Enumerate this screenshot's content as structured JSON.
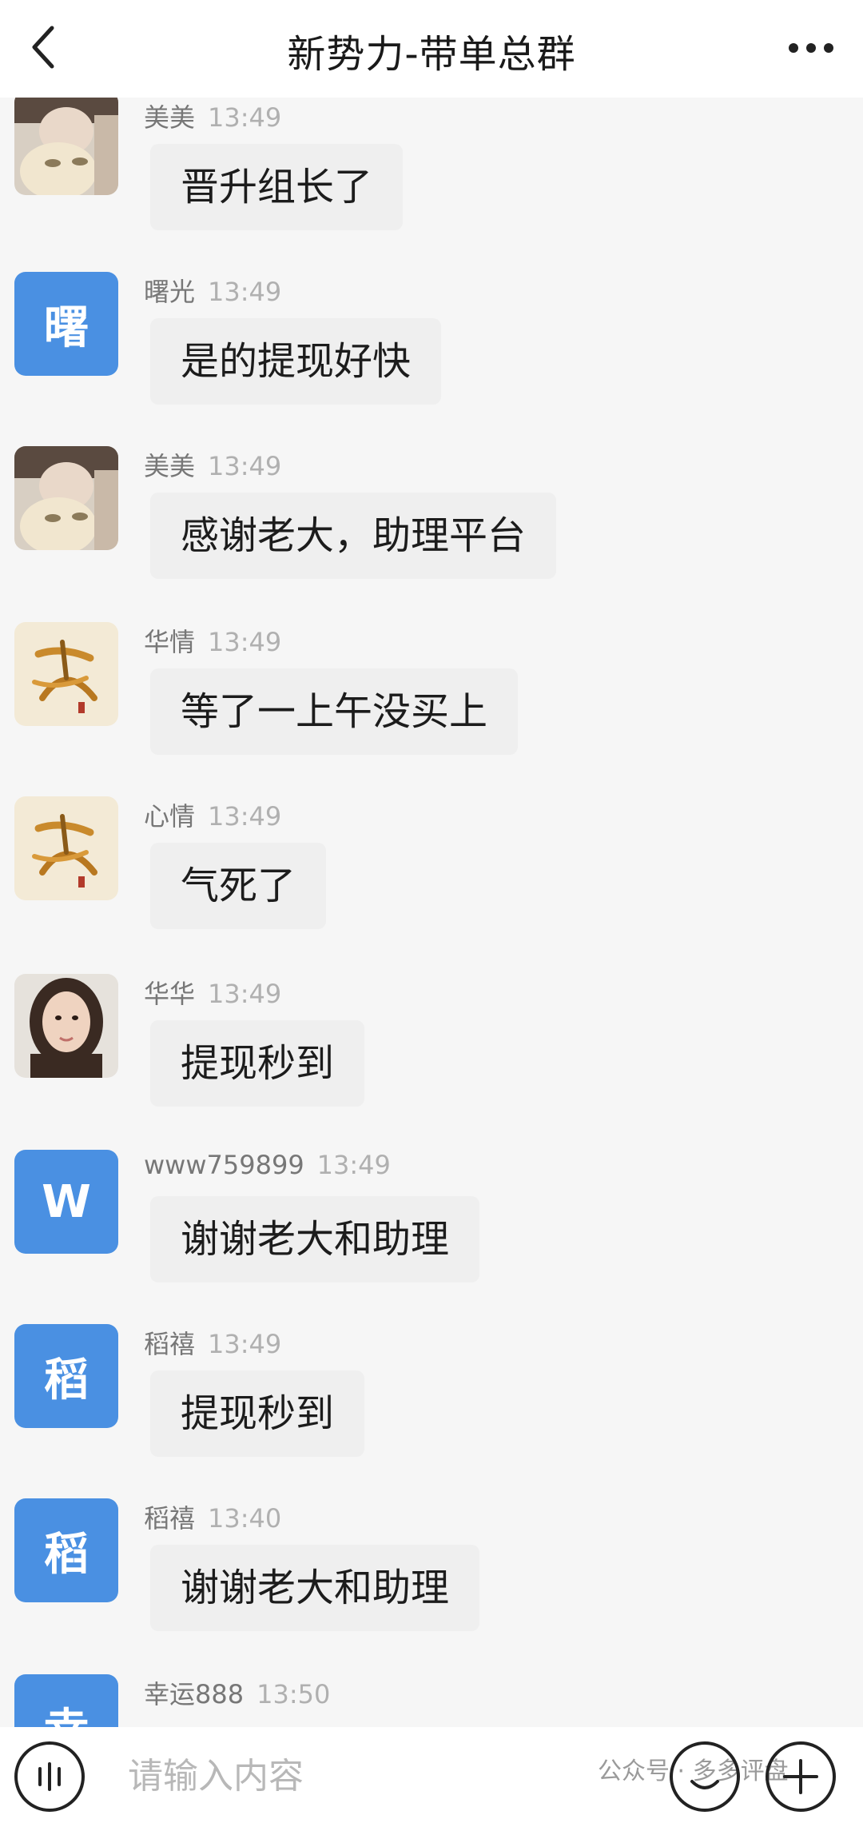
{
  "header": {
    "back_icon": "chevron-left-icon",
    "title": "新势力-带单总群",
    "more_icon": "more-dots-icon"
  },
  "messages": [
    {
      "name": "美美",
      "time": "13:49",
      "text": "晋升组长了",
      "avatar": "photo-girl"
    },
    {
      "name": "曙光",
      "time": "13:49",
      "text": "是的提现好快",
      "avatar_letter": "曙",
      "avatar_color": "#4a90e2"
    },
    {
      "name": "美美",
      "time": "13:49",
      "text": "感谢老大，助理平台",
      "avatar": "photo-girl"
    },
    {
      "name": "华情",
      "time": "13:49",
      "text": "等了一上午没买上",
      "avatar": "calligraphy"
    },
    {
      "name": "心情",
      "time": "13:49",
      "text": "气死了",
      "avatar": "calligraphy"
    },
    {
      "name": "华华",
      "time": "13:49",
      "text": "提现秒到",
      "avatar": "photo-woman"
    },
    {
      "name": "www759899",
      "time": "13:49",
      "text": "谢谢老大和助理",
      "avatar_letter": "W",
      "avatar_color": "#4a90e2"
    },
    {
      "name": "稻禧",
      "time": "13:49",
      "text": "提现秒到",
      "avatar_letter": "稻",
      "avatar_color": "#4a90e2"
    },
    {
      "name": "稻禧",
      "time": "13:40",
      "text": "谢谢老大和助理",
      "avatar_letter": "稻",
      "avatar_color": "#4a90e2"
    },
    {
      "name": "幸运888",
      "time": "13:50",
      "text": "",
      "avatar_letter": "幸",
      "avatar_color": "#4a90e2"
    }
  ],
  "input": {
    "placeholder": "请输入内容",
    "voice_icon": "voice-icon",
    "emoji_icon": "emoji-icon",
    "plus_icon": "plus-icon"
  },
  "watermark": "公众号 · 多多评盘",
  "colors": {
    "accent": "#4a90e2",
    "bubble": "#efefef",
    "background": "#f6f6f6"
  }
}
